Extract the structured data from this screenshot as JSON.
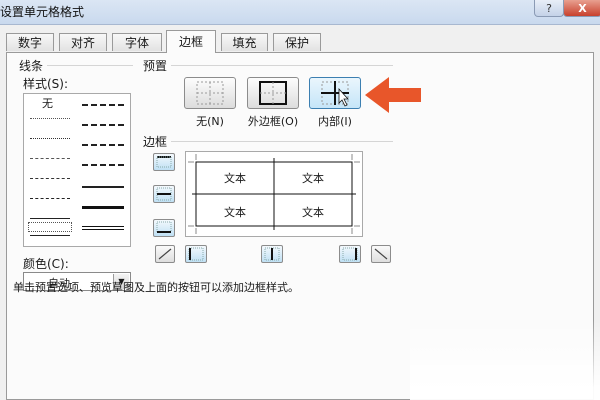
{
  "window": {
    "title": "设置单元格格式"
  },
  "title_buttons": {
    "help": "?",
    "close": "X"
  },
  "tabs": [
    {
      "label": "数字"
    },
    {
      "label": "对齐"
    },
    {
      "label": "字体"
    },
    {
      "label": "边框",
      "active": true
    },
    {
      "label": "填充"
    },
    {
      "label": "保护"
    }
  ],
  "line": {
    "group_label": "线条",
    "style_label": "样式(S):",
    "none_label": "无",
    "color_label": "颜色(C):",
    "color_value": "自动"
  },
  "presets": {
    "group_label": "预置",
    "items": [
      {
        "label": "无(N)"
      },
      {
        "label": "外边框(O)"
      },
      {
        "label": "内部(I)"
      }
    ]
  },
  "border": {
    "group_label": "边框",
    "preview_cells": [
      "文本",
      "文本",
      "文本",
      "文本"
    ]
  },
  "hint": "单击预置选项、预览草图及上面的按钮可以添加边框样式。",
  "colors": {
    "accent": "#3c7fb1",
    "arrow": "#e8562a"
  },
  "icons": {
    "arrow": "pointer-arrow-icon",
    "cursor": "mouse-cursor-icon"
  }
}
